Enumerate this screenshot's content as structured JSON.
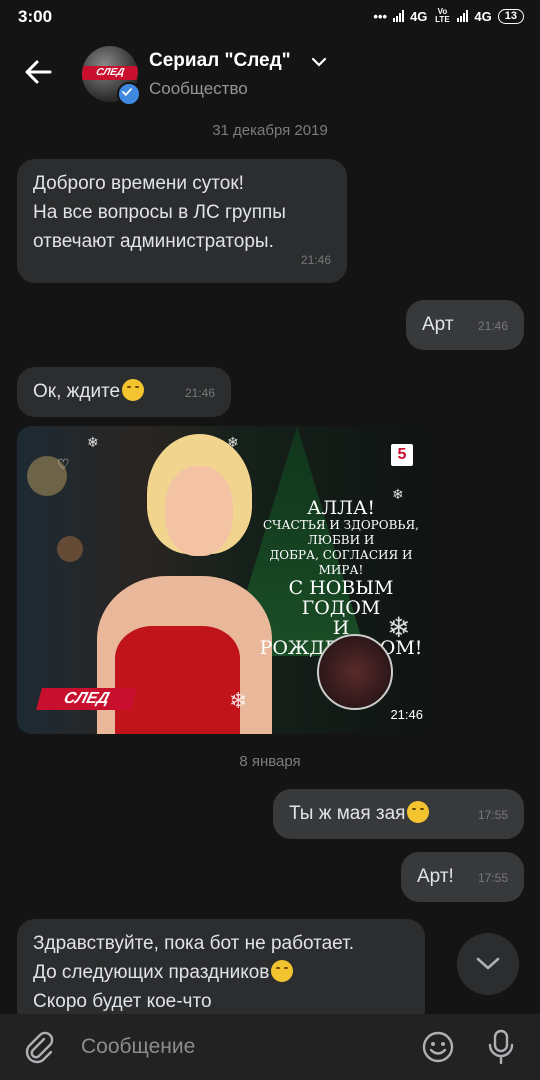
{
  "status_bar": {
    "time": "3:00",
    "net1": "4G",
    "net2": "4G",
    "volte": "Vo LTE",
    "battery": "13"
  },
  "header": {
    "title": "Сериал \"След\"",
    "subtitle": "Сообщество",
    "avatar_logo": "СЛЕД"
  },
  "chat": {
    "date1": "31 декабря 2019",
    "msg1_line1": "Доброго времени суток!",
    "msg1_line2": "На все вопросы в ЛС группы",
    "msg1_line3": "отвечают администраторы.",
    "msg1_time": "21:46",
    "msg2_text": "Арт",
    "msg2_time": "21:46",
    "msg3_text": "Ок, ждите",
    "msg3_time": "21:46",
    "image": {
      "title_line1": "АЛЛА!",
      "small_line1": "СЧАСТЬЯ И ЗДОРОВЬЯ, ЛЮБВИ И",
      "small_line2": "ДОБРА, СОГЛАСИЯ И МИРА!",
      "big_line1": "С НОВЫМ ГОДОМ",
      "big_line2": "И РОЖДЕСТВОМ!",
      "channel": "5",
      "logo": "СЛЕД",
      "time": "21:46"
    },
    "date2": "8 января",
    "msg4_text": "Ты ж мая зая",
    "msg4_time": "17:55",
    "msg5_text": "Арт!",
    "msg5_time": "17:55",
    "msg6_line1": "Здравствуйте, пока бот не работает.",
    "msg6_line2": "До следующих праздников",
    "msg6_line3": "Скоро будет кое-что"
  },
  "composer": {
    "placeholder": "Сообщение"
  },
  "icons": [
    "back-arrow-icon",
    "chevron-down-icon",
    "verified-icon",
    "paperclip-icon",
    "smile-icon",
    "microphone-icon",
    "scroll-down-icon"
  ]
}
